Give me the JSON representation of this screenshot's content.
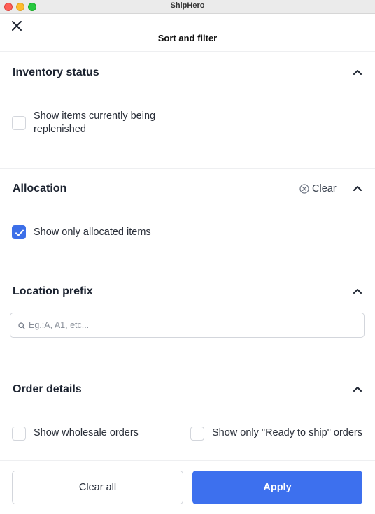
{
  "window": {
    "title": "ShipHero"
  },
  "header": {
    "title": "Sort and filter",
    "close_icon": "close-icon"
  },
  "inventory_status": {
    "title": "Inventory status",
    "option_line1": "Show items currently being",
    "option_line2": "replenished",
    "checked": false
  },
  "allocation": {
    "title": "Allocation",
    "clear_label": "Clear",
    "option": "Show only allocated items",
    "checked": true
  },
  "location_prefix": {
    "title": "Location prefix",
    "placeholder": "Eg.:A, A1, etc...",
    "value": ""
  },
  "order_details": {
    "title": "Order details",
    "options": [
      {
        "label": "Show wholesale orders",
        "checked": false
      },
      {
        "label": "Show only \"Ready to ship\" orders",
        "checked": false
      }
    ]
  },
  "footer": {
    "clear_all_label": "Clear all",
    "apply_label": "Apply"
  },
  "colors": {
    "accent": "#3d70ee",
    "divider": "#eeeff1",
    "text": "#1c2330"
  }
}
